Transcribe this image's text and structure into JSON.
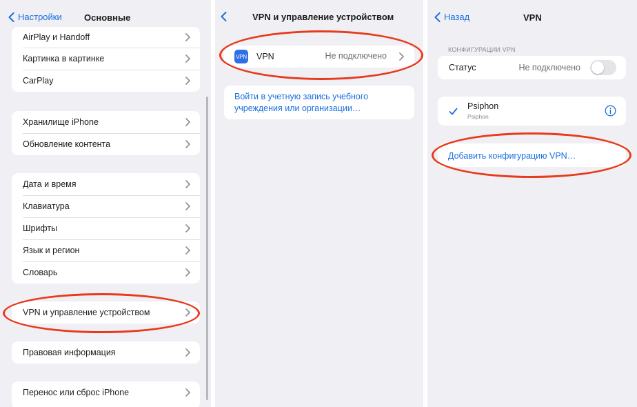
{
  "panel1": {
    "back_label": "Настройки",
    "title": "Основные",
    "groups": [
      [
        "AirPlay и Handoff",
        "Картинка в картинке",
        "CarPlay"
      ],
      [
        "Хранилище iPhone",
        "Обновление контента"
      ],
      [
        "Дата и время",
        "Клавиатура",
        "Шрифты",
        "Язык и регион",
        "Словарь"
      ],
      [
        "VPN и управление устройством"
      ],
      [
        "Правовая информация"
      ],
      [
        "Перенос или сброс iPhone"
      ]
    ]
  },
  "panel2": {
    "title": "VPN и управление устройством",
    "vpn_icon_text": "VPN",
    "vpn_label": "VPN",
    "vpn_status": "Не подключено",
    "login_link": "Войти в учетную запись учебного учреждения или организации…"
  },
  "panel3": {
    "back_label": "Назад",
    "title": "VPN",
    "section_header": "КОНФИГУРАЦИИ VPN",
    "status_label": "Статус",
    "status_value": "Не подключено",
    "toggle_on": false,
    "config_name": "Psiphon",
    "config_subtitle": "Psiphon",
    "add_config": "Добавить конфигурацию VPN…"
  },
  "colors": {
    "accent": "#1a6fe0",
    "highlight": "#e83a1c",
    "background": "#f0f0f4",
    "vpn_icon": "#2f6fe6"
  },
  "icons": [
    "chevron-left-icon",
    "chevron-right-icon",
    "vpn-app-icon",
    "checkmark-icon",
    "info-icon"
  ]
}
